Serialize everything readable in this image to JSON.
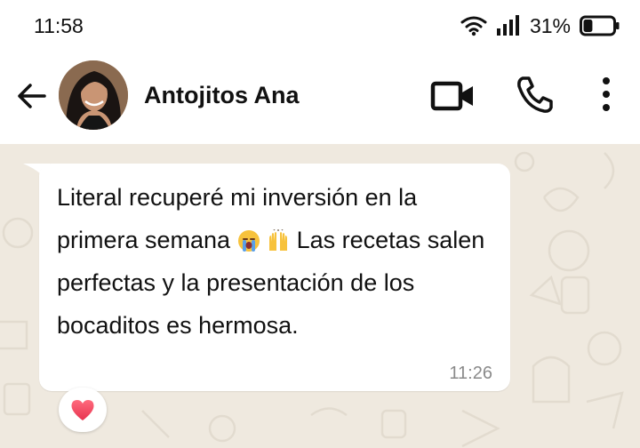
{
  "status_bar": {
    "time": "11:58",
    "battery_percent": "31%",
    "battery_level": 0.31
  },
  "header": {
    "contact_name": "Antojitos Ana"
  },
  "message": {
    "text_part1": "Literal recuperé mi inversión en la primera semana",
    "emojis": [
      "crying-face",
      "raising-hands"
    ],
    "text_part2": "Las recetas salen perfectas y la presentación de los bocaditos es hermosa.",
    "time": "11:26",
    "reaction": "heart"
  },
  "colors": {
    "chat_background": "#efe9df",
    "bubble": "#ffffff",
    "reaction_heart": "#e8334f"
  }
}
